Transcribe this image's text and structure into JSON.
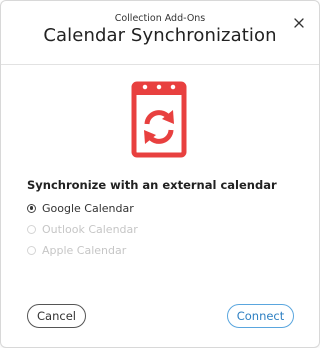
{
  "dialog": {
    "subtitle": "Collection Add-Ons",
    "title": "Calendar Synchronization",
    "close_icon": "close-x-icon",
    "feature_icon": "calendar-sync-icon",
    "accent_color": "#e8403f"
  },
  "sync": {
    "heading": "Synchronize with an external calendar",
    "options": [
      {
        "label": "Google Calendar",
        "selected": true,
        "enabled": true
      },
      {
        "label": "Outlook Calendar",
        "selected": false,
        "enabled": false
      },
      {
        "label": "Apple Calendar",
        "selected": false,
        "enabled": false
      }
    ]
  },
  "footer": {
    "cancel_label": "Cancel",
    "connect_label": "Connect",
    "connect_color": "#2f80c2"
  }
}
